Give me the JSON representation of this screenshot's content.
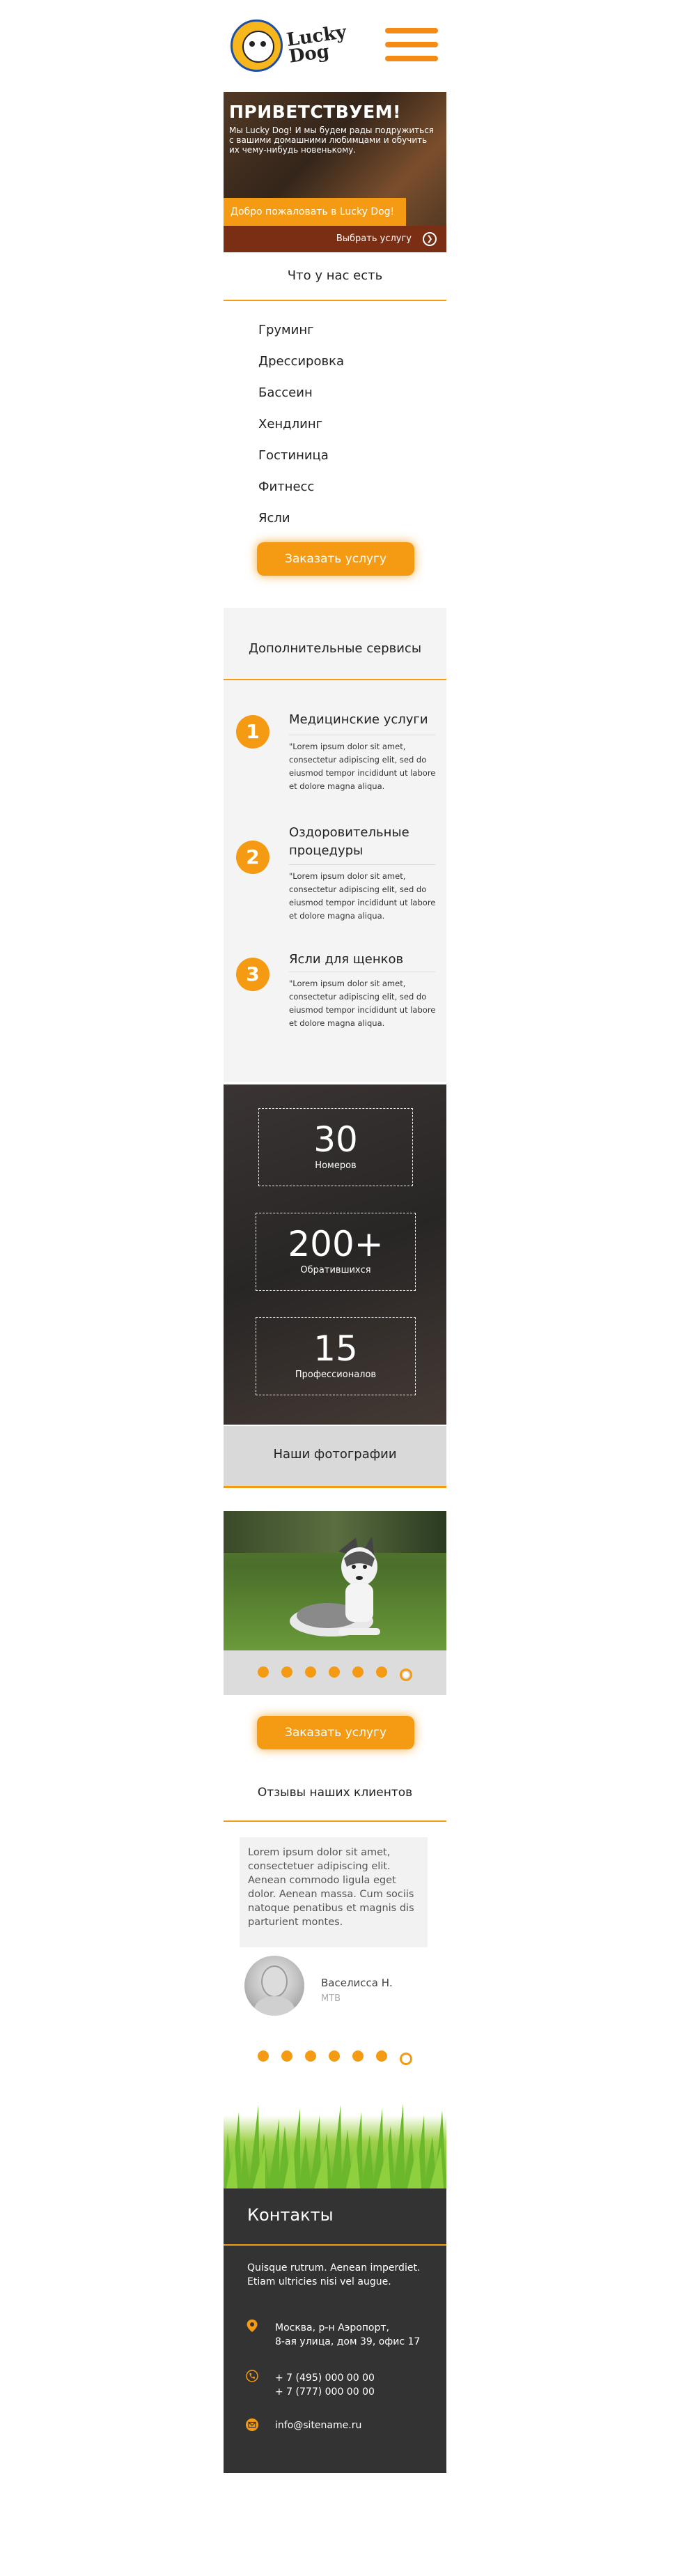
{
  "header": {
    "logo_text_line1": "Lucky",
    "logo_text_line2": "Dog"
  },
  "hero": {
    "title": "ПРИВЕТСТВУЕМ!",
    "text": "Мы Lucky Dog! И мы будем рады подружиться с вашими домашними любимцами и обучить их чему-нибудь новенькому.",
    "welcome": "Добро пожаловать в Lucky Dog!",
    "choose": "Выбрать услугу"
  },
  "services": {
    "title": "Что у нас есть",
    "items": [
      "Груминг",
      "Дрессировка",
      "Бассеин",
      "Хендлинг",
      "Гостиница",
      "Фитнесс",
      "Ясли"
    ],
    "order_button": "Заказать услугу"
  },
  "extra": {
    "title": "Дополнительные сервисы",
    "items": [
      {
        "num": "1",
        "name": "Медицинские услуги",
        "desc": "\"Lorem ipsum dolor sit amet, consectetur adipiscing elit, sed do eiusmod tempor incididunt ut labore et dolore magna aliqua."
      },
      {
        "num": "2",
        "name": "Оздоровительные процедуры",
        "desc": "\"Lorem ipsum dolor sit amet, consectetur adipiscing elit, sed do eiusmod tempor incididunt ut labore et dolore magna aliqua."
      },
      {
        "num": "3",
        "name": "Ясли для щенков",
        "desc": "\"Lorem ipsum dolor sit amet, consectetur adipiscing elit, sed do eiusmod tempor incididunt ut labore et dolore magna aliqua."
      }
    ]
  },
  "stats": [
    {
      "num": "30",
      "label": "Номеров"
    },
    {
      "num": "200+",
      "label": "Обратившихся"
    },
    {
      "num": "15",
      "label": "Профессионалов"
    }
  ],
  "photos": {
    "title": "Наши фотографии",
    "dots_count": 7,
    "active_dot": 7,
    "order_button": "Заказать услугу"
  },
  "reviews": {
    "title": "Отзывы наших клиентов",
    "text": "Lorem ipsum dolor sit amet, consectetuer adipiscing elit. Aenean commodo ligula eget dolor. Aenean massa. Cum sociis natoque penatibus et magnis dis parturient montes.",
    "name": "Васелисса Н.",
    "org": "МТВ"
  },
  "contacts": {
    "title": "Контакты",
    "intro": "Quisque rutrum. Aenean imperdiet. Etiam ultricies nisi vel augue.",
    "address_line1": "Москва, р-н Аэропорт,",
    "address_line2": "8-ая улица, дом 39, офис 17",
    "phone1": "+ 7 (495) 000 00 00",
    "phone2": "+ 7 (777) 000 00 00",
    "email": "info@sitename.ru"
  },
  "colors": {
    "accent": "#f59a13",
    "dark": "#333333",
    "hero_bar": "#7a2e14"
  }
}
